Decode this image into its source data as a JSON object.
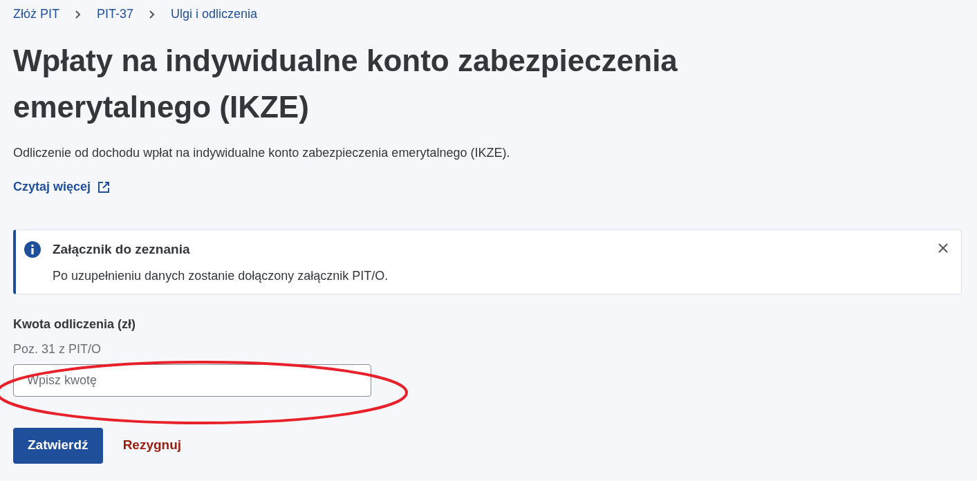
{
  "breadcrumb": [
    {
      "label": "Złóż PIT"
    },
    {
      "label": "PIT-37"
    },
    {
      "label": "Ulgi i odliczenia"
    }
  ],
  "title": "Wpłaty na indywidualne konto zabezpieczenia emerytalnego (IKZE)",
  "description": "Odliczenie od dochodu wpłat na indywidualne konto zabezpieczenia emerytalnego (IKZE).",
  "read_more_link": "Czytaj więcej",
  "alert": {
    "title": "Załącznik do zeznania",
    "message": "Po uzupełnieniu danych zostanie dołączony załącznik PIT/O."
  },
  "field": {
    "label": "Kwota odliczenia (zł)",
    "hint": "Poz. 31 z PIT/O",
    "placeholder": "Wpisz kwotę"
  },
  "buttons": [
    {
      "label": "Zatwierdź",
      "kind": "primary"
    },
    {
      "label": "Rezygnuj",
      "kind": "cancel"
    }
  ]
}
